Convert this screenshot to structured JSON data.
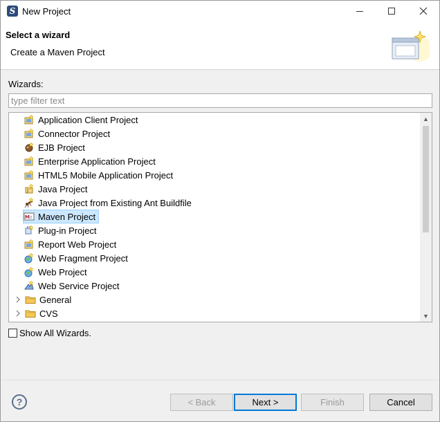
{
  "window": {
    "title": "New Project"
  },
  "header": {
    "title": "Select a wizard",
    "description": "Create a Maven Project"
  },
  "wizards_label": "Wizards:",
  "filter": {
    "placeholder": "type filter text",
    "value": ""
  },
  "tree": {
    "items": [
      {
        "label": "Application Client Project",
        "icon": "project-icon"
      },
      {
        "label": "Connector Project",
        "icon": "project-icon"
      },
      {
        "label": "EJB Project",
        "icon": "ejb-icon"
      },
      {
        "label": "Enterprise Application Project",
        "icon": "project-icon"
      },
      {
        "label": "HTML5 Mobile Application Project",
        "icon": "project-icon"
      },
      {
        "label": "Java Project",
        "icon": "java-project-icon"
      },
      {
        "label": "Java Project from Existing Ant Buildfile",
        "icon": "ant-icon"
      },
      {
        "label": "Maven Project",
        "icon": "maven-icon",
        "selected": true
      },
      {
        "label": "Plug-in Project",
        "icon": "plugin-icon"
      },
      {
        "label": "Report Web Project",
        "icon": "project-icon"
      },
      {
        "label": "Web Fragment Project",
        "icon": "globe-project-icon"
      },
      {
        "label": "Web Project",
        "icon": "globe-project-icon"
      },
      {
        "label": "Web Service Project",
        "icon": "webservice-icon"
      }
    ],
    "categories": [
      {
        "label": "General",
        "icon": "folder-icon"
      },
      {
        "label": "CVS",
        "icon": "folder-icon"
      }
    ]
  },
  "show_all": {
    "label": "Show All Wizards.",
    "checked": false
  },
  "buttons": {
    "back": "< Back",
    "next": "Next >",
    "finish": "Finish",
    "cancel": "Cancel"
  },
  "colors": {
    "selection_bg": "#cce8ff",
    "selection_border": "#99d1ff",
    "default_button_border": "#0078d7"
  }
}
